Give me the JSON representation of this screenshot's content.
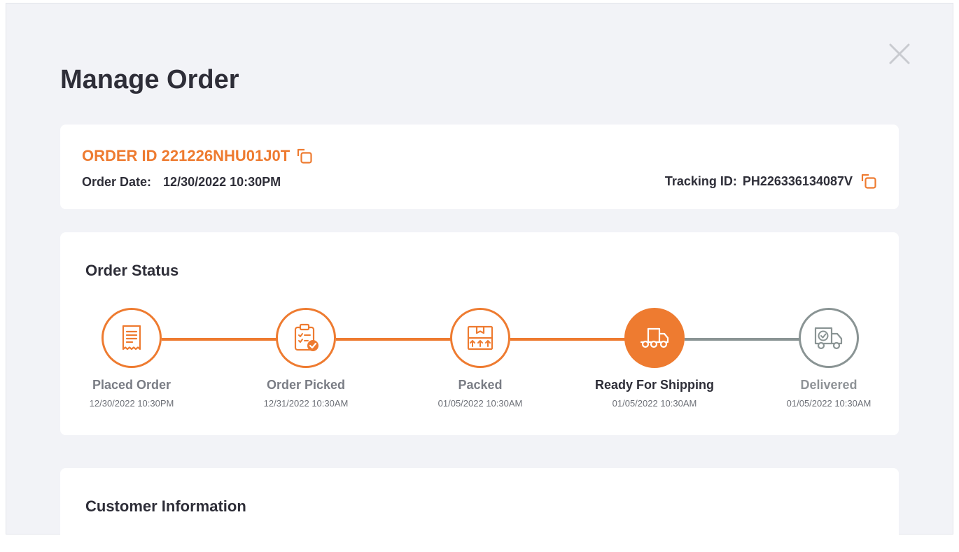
{
  "page": {
    "title": "Manage Order"
  },
  "order": {
    "order_id": "ORDER ID 221226NHU01J0T",
    "order_date_label": "Order Date:",
    "order_date": "12/30/2022 10:30PM",
    "tracking_label": "Tracking ID:",
    "tracking_id": "PH226336134087V"
  },
  "status": {
    "title": "Order Status",
    "steps": [
      {
        "label": "Placed Order",
        "date": "12/30/2022 10:30PM",
        "icon": "receipt-icon",
        "state": "done"
      },
      {
        "label": "Order Picked",
        "date": "12/31/2022 10:30AM",
        "icon": "clipboard-check-icon",
        "state": "done"
      },
      {
        "label": "Packed",
        "date": "01/05/2022 10:30AM",
        "icon": "package-icon",
        "state": "done"
      },
      {
        "label": "Ready For Shipping",
        "date": "01/05/2022 10:30AM",
        "icon": "truck-icon",
        "state": "active"
      },
      {
        "label": "Delivered",
        "date": "01/05/2022 10:30AM",
        "icon": "truck-check-icon",
        "state": "pending"
      }
    ]
  },
  "customer": {
    "title": "Customer Information"
  },
  "colors": {
    "accent": "#ee7b30",
    "pending": "#8a9494",
    "background": "#f2f3f7"
  }
}
